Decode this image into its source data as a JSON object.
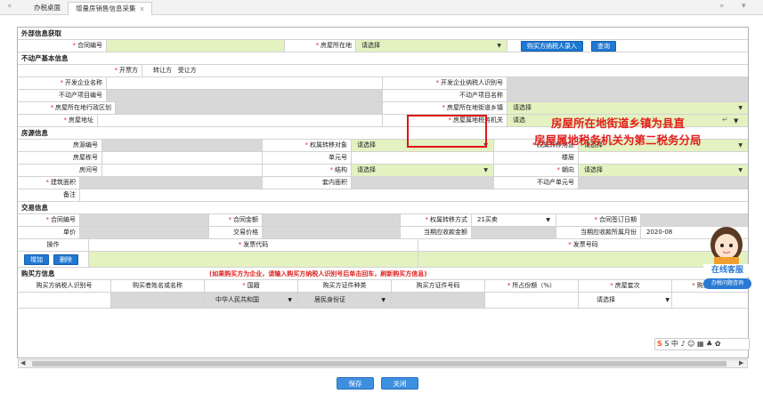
{
  "tabs": {
    "prev": "«",
    "home": "办税桌面",
    "active": "增量房销售信息采集",
    "close": "x",
    "next": "»",
    "menu": "▾"
  },
  "sections": {
    "external": "外部信息获取",
    "estate": "不动产基本信息",
    "house": "房源信息",
    "trade": "交易信息",
    "buyer": "购买方信息"
  },
  "external": {
    "contract_no": "合同编号",
    "location": "房屋所在地",
    "location_value": "请选择",
    "btn_entry": "购买方纳税人录入",
    "btn_query": "查询"
  },
  "estate": {
    "seller_label": "开票方",
    "transferor": "转让方",
    "transferee": "受让方",
    "dev_name": "开发企业名称",
    "dev_taxid": "开发企业纳税人识别号",
    "proj_no": "不动产项目编号",
    "proj_name": "不动产项目名称",
    "district": "房屋所在地行政区划",
    "street": "房屋所在地街道乡镇",
    "street_value": "请选择",
    "address": "房屋地址",
    "tax_office": "房屋属地税务机关",
    "tax_office_value": "请选"
  },
  "annotations": {
    "line1": "房屋所在地街道乡镇为县直",
    "line2": "房屋属地税务机关为第二税务分局"
  },
  "house": {
    "source_no": "房源编号",
    "transfer_obj": "权属转移对象",
    "transfer_obj_value": "请选择",
    "transfer_use": "权属转移用途",
    "transfer_use_value": "请选择",
    "building_no": "房屋栋号",
    "unit_no": "单元号",
    "floor": "楼层",
    "room_no": "房间号",
    "structure": "结构",
    "structure_value": "请选择",
    "orientation": "朝向",
    "orientation_value": "请选择",
    "built_area": "建筑面积",
    "inner_area": "套内面积",
    "unit_code": "不动产单元号",
    "remark": "备注"
  },
  "trade": {
    "contract_no": "合同编号",
    "amount": "合同金额",
    "method": "权属转移方式",
    "method_value": "21买卖",
    "sign_date": "合同签订日期",
    "unit_price": "单价",
    "trade_price": "交易价格",
    "period_amount": "当期应收款金额",
    "period_month": "当期应收款所属月份",
    "period_month_value": "2020-08",
    "op": "操作",
    "invoice_code": "发票代码",
    "invoice_no": "发票号码",
    "btn_add": "增加",
    "btn_del": "删除"
  },
  "buyer": {
    "note": "(如果购买方为企业，请输入购买方纳税人识别号后单击回车，刷新购买方信息)",
    "taxid": "购买方纳税人识别号",
    "name": "购买者姓名或名称",
    "nation": "国籍",
    "nation_value": "中华人民共和国",
    "id_type": "购买方证件种类",
    "id_type_value": "居民身份证",
    "id_no": "购买方证件号码",
    "share": "所占份额（%）",
    "suite": "房屋套次",
    "suite_value": "请选择",
    "addr": "购买方地址"
  },
  "footer": {
    "save": "保存",
    "close": "关闭"
  },
  "chat": {
    "title": "在线客服",
    "sub": "办税问题咨询"
  },
  "ime": {
    "text": "S 中 ♪ ☺ ▦ ♣ ✿"
  }
}
